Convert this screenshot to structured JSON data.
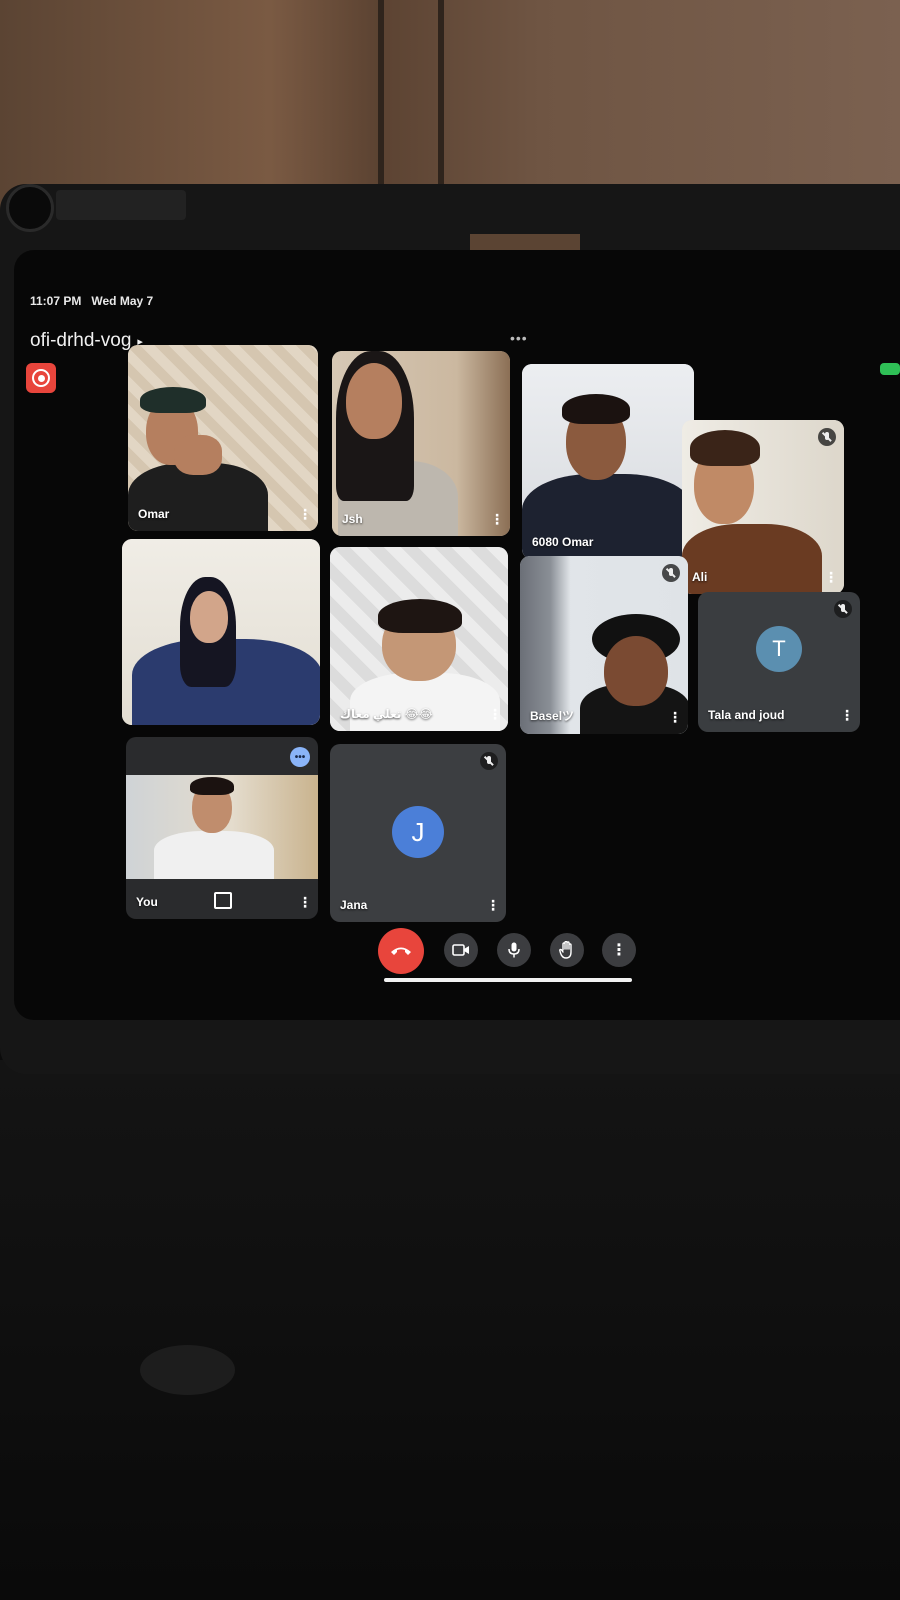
{
  "status_bar": {
    "time": "11:07 PM",
    "date": "Wed May 7"
  },
  "meeting": {
    "code": "ofi-drhd-vog",
    "code_chevron_icon": "chevron-right-icon",
    "recording_icon": "record-icon"
  },
  "tiles": [
    {
      "id": "omar",
      "name": "Omar"
    },
    {
      "id": "jsh",
      "name": "Jsh"
    },
    {
      "id": "omar6080",
      "name": "6080 Omar"
    },
    {
      "id": "ali",
      "name": "Ali"
    },
    {
      "id": "hijab",
      "name": ""
    },
    {
      "id": "taalimaak",
      "name": "تعلي معاك 😂😂"
    },
    {
      "id": "basel",
      "name": "Baselツ"
    },
    {
      "id": "tala",
      "name": "Tala and joud",
      "avatar_letter": "T",
      "avatar_color": "#5b8fb0"
    },
    {
      "id": "you",
      "name": "You"
    },
    {
      "id": "jana",
      "name": "Jana",
      "avatar_letter": "J",
      "avatar_color": "#4b7fd8"
    }
  ],
  "controls": {
    "end_call_icon": "end-call-icon",
    "camera_icon": "video-camera-icon",
    "mic_icon": "microphone-icon",
    "raise_hand_icon": "raise-hand-icon",
    "more_icon": "more-options-icon"
  },
  "colors": {
    "end_call": "#e8453c",
    "control_bg": "#3c3d40",
    "tile_bg": "#3a3b3d",
    "accent_blue": "#8ab4f8"
  }
}
